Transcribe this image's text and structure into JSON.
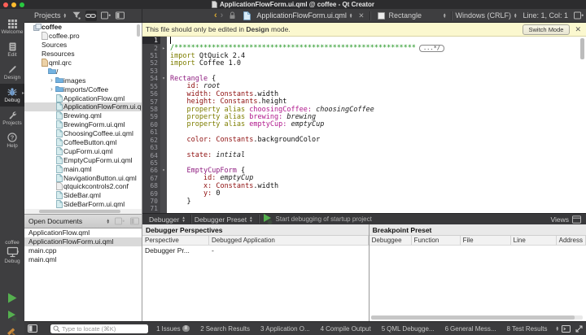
{
  "titlebar": {
    "title": "ApplicationFlowForm.ui.qml @ coffee - Qt Creator"
  },
  "rail": {
    "modes": [
      {
        "label": "Welcome",
        "icon": "grid",
        "selected": false
      },
      {
        "label": "Edit",
        "icon": "edit-doc",
        "selected": false
      },
      {
        "label": "Design",
        "icon": "pencil",
        "selected": false
      },
      {
        "label": "Debug",
        "icon": "bug",
        "selected": true
      },
      {
        "label": "Projects",
        "icon": "wrench",
        "selected": false
      },
      {
        "label": "Help",
        "icon": "help",
        "selected": false
      }
    ],
    "kit": {
      "project": "coffee",
      "config": "Debug"
    }
  },
  "projects_panel": {
    "title": "Projects",
    "tree": [
      {
        "label": "coffee",
        "icon": "project",
        "indent": 0,
        "bold": true,
        "chevron": ""
      },
      {
        "label": "coffee.pro",
        "icon": "doc",
        "indent": 1
      },
      {
        "label": "Sources",
        "icon": "none",
        "indent": 1
      },
      {
        "label": "Resources",
        "icon": "none",
        "indent": 1
      },
      {
        "label": "qml.qrc",
        "icon": "qrc",
        "indent": 1
      },
      {
        "label": "/",
        "icon": "folder",
        "indent": 2
      },
      {
        "label": "images",
        "icon": "folder",
        "indent": 3,
        "chevron": "›"
      },
      {
        "label": "imports/Coffee",
        "icon": "folder",
        "indent": 3,
        "chevron": "›"
      },
      {
        "label": "ApplicationFlow.qml",
        "icon": "qml",
        "indent": 3
      },
      {
        "label": "ApplicationFlowForm.ui.qml",
        "icon": "qml",
        "indent": 3,
        "selected": true
      },
      {
        "label": "Brewing.qml",
        "icon": "qml",
        "indent": 3
      },
      {
        "label": "BrewingForm.ui.qml",
        "icon": "qml",
        "indent": 3
      },
      {
        "label": "ChoosingCoffee.ui.qml",
        "icon": "qml",
        "indent": 3
      },
      {
        "label": "CoffeeButton.qml",
        "icon": "qml",
        "indent": 3
      },
      {
        "label": "CupForm.ui.qml",
        "icon": "qml",
        "indent": 3
      },
      {
        "label": "EmptyCupForm.ui.qml",
        "icon": "qml",
        "indent": 3
      },
      {
        "label": "main.qml",
        "icon": "qml",
        "indent": 3
      },
      {
        "label": "NavigationButton.ui.qml",
        "icon": "qml",
        "indent": 3
      },
      {
        "label": "qtquickcontrols2.conf",
        "icon": "doc",
        "indent": 3
      },
      {
        "label": "SideBar.qml",
        "icon": "qml",
        "indent": 3
      },
      {
        "label": "SideBarForm.ui.qml",
        "icon": "qml",
        "indent": 3
      }
    ]
  },
  "opendocs": {
    "title": "Open Documents",
    "items": [
      "ApplicationFlow.qml",
      "ApplicationFlowForm.ui.qml",
      "main.cpp",
      "main.qml"
    ],
    "selected_index": 1
  },
  "editor": {
    "toolbar": {
      "document": "ApplicationFlowForm.ui.qml",
      "symbol": "Rectangle",
      "line_ending": "Windows (CRLF)",
      "cursor_pos": "Line: 1, Col: 1"
    },
    "infobar": {
      "prefix": "This file should only be edited in ",
      "bold": "Design",
      "suffix": " mode.",
      "button": "Switch Mode"
    },
    "code": {
      "lines": [
        {
          "n": "1",
          "cur": true,
          "toks": []
        },
        {
          "n": "2",
          "fold": "closed",
          "foldbox": "...*/",
          "toks": [
            [
              "c",
              "/**********************************************************"
            ]
          ]
        },
        {
          "n": "51",
          "toks": [
            [
              "k",
              "import"
            ],
            [
              "n",
              " QtQuick 2.4"
            ]
          ]
        },
        {
          "n": "52",
          "toks": [
            [
              "k",
              "import"
            ],
            [
              "n",
              " Coffee 1.0"
            ]
          ]
        },
        {
          "n": "53",
          "toks": []
        },
        {
          "n": "54",
          "fold": "open",
          "toks": [
            [
              "t",
              "Rectangle"
            ],
            [
              "n",
              " {"
            ]
          ]
        },
        {
          "n": "55",
          "toks": [
            [
              "n",
              "    "
            ],
            [
              "p",
              "id:"
            ],
            [
              "i",
              " root"
            ]
          ]
        },
        {
          "n": "56",
          "toks": [
            [
              "n",
              "    "
            ],
            [
              "p",
              "width:"
            ],
            [
              "n",
              " "
            ],
            [
              "p",
              "Constants"
            ],
            [
              "n",
              ".width"
            ]
          ]
        },
        {
          "n": "57",
          "toks": [
            [
              "n",
              "    "
            ],
            [
              "p",
              "height:"
            ],
            [
              "n",
              " "
            ],
            [
              "p",
              "Constants"
            ],
            [
              "n",
              ".height"
            ]
          ]
        },
        {
          "n": "58",
          "toks": [
            [
              "n",
              "    "
            ],
            [
              "k",
              "property alias"
            ],
            [
              "n",
              " "
            ],
            [
              "a",
              "choosingCoffee:"
            ],
            [
              "i",
              " choosingCoffee"
            ]
          ]
        },
        {
          "n": "59",
          "toks": [
            [
              "n",
              "    "
            ],
            [
              "k",
              "property alias"
            ],
            [
              "n",
              " "
            ],
            [
              "a",
              "brewing:"
            ],
            [
              "i",
              " brewing"
            ]
          ]
        },
        {
          "n": "60",
          "toks": [
            [
              "n",
              "    "
            ],
            [
              "k",
              "property alias"
            ],
            [
              "n",
              " "
            ],
            [
              "a",
              "emptyCup:"
            ],
            [
              "i",
              " emptyCup"
            ]
          ]
        },
        {
          "n": "61",
          "toks": []
        },
        {
          "n": "62",
          "toks": [
            [
              "n",
              "    "
            ],
            [
              "p",
              "color:"
            ],
            [
              "n",
              " "
            ],
            [
              "p",
              "Constants"
            ],
            [
              "n",
              ".backgroundColor"
            ]
          ]
        },
        {
          "n": "63",
          "toks": []
        },
        {
          "n": "64",
          "toks": [
            [
              "n",
              "    "
            ],
            [
              "p",
              "state:"
            ],
            [
              "i",
              " intital"
            ]
          ]
        },
        {
          "n": "65",
          "toks": []
        },
        {
          "n": "66",
          "fold": "open",
          "toks": [
            [
              "n",
              "    "
            ],
            [
              "t",
              "EmptyCupForm"
            ],
            [
              "n",
              " {"
            ]
          ]
        },
        {
          "n": "67",
          "toks": [
            [
              "n",
              "        "
            ],
            [
              "p",
              "id:"
            ],
            [
              "i",
              " emptyCup"
            ]
          ]
        },
        {
          "n": "68",
          "toks": [
            [
              "n",
              "        "
            ],
            [
              "p",
              "x:"
            ],
            [
              "n",
              " "
            ],
            [
              "p",
              "Constants"
            ],
            [
              "n",
              ".width"
            ]
          ]
        },
        {
          "n": "69",
          "toks": [
            [
              "n",
              "        "
            ],
            [
              "p",
              "y:"
            ],
            [
              "n",
              " 0"
            ]
          ]
        },
        {
          "n": "70",
          "toks": [
            [
              "n",
              "    }"
            ]
          ]
        },
        {
          "n": "71",
          "toks": []
        }
      ]
    }
  },
  "debugger": {
    "toolbar": {
      "engine": "Debugger",
      "preset": "Debugger Preset",
      "start_label": "Start debugging of startup project",
      "views_label": "Views"
    },
    "perspectives": {
      "title": "Debugger Perspectives",
      "columns": [
        "Perspective",
        "Debugged Application"
      ],
      "rows": [
        [
          "Debugger Pr...",
          "-"
        ]
      ]
    },
    "breakpoints": {
      "title": "Breakpoint Preset",
      "columns": [
        "Debuggee",
        "Function",
        "File",
        "Line",
        "Address"
      ],
      "rows": []
    }
  },
  "statusbar": {
    "locator_placeholder": "Type to locate (⌘K)",
    "panes": [
      {
        "key": "1",
        "label": "Issues",
        "badge": "8"
      },
      {
        "key": "2",
        "label": "Search Results"
      },
      {
        "key": "3",
        "label": "Application O..."
      },
      {
        "key": "4",
        "label": "Compile Output"
      },
      {
        "key": "5",
        "label": "QML Debugge..."
      },
      {
        "key": "6",
        "label": "General Mess..."
      },
      {
        "key": "8",
        "label": "Test Results"
      }
    ]
  }
}
